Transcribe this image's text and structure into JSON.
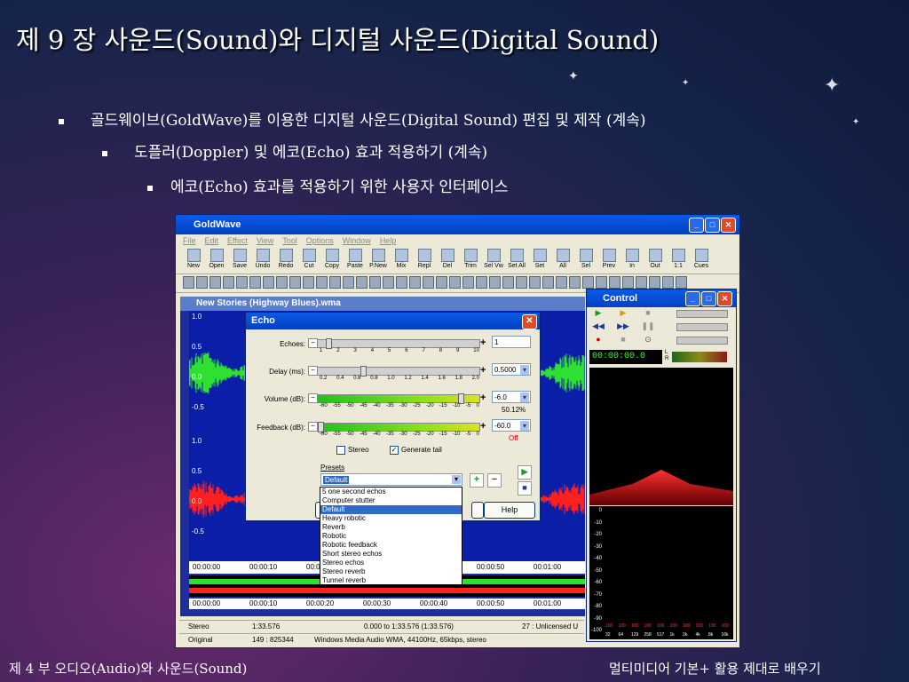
{
  "slide": {
    "title": "제 9 장 사운드(Sound)와 디지털 사운드(Digital Sound)",
    "bullet1": "골드웨이브(GoldWave)를 이용한 디지털 사운드(Digital Sound) 편집 및 제작 (계속)",
    "bullet2": "도플러(Doppler) 및 에코(Echo) 효과 적용하기 (계속)",
    "bullet3": "에코(Echo) 효과를 적용하기 위한 사용자 인터페이스",
    "footer_left": "제 4 부 오디오(Audio)와 사운드(Sound)",
    "footer_right": "멀티미디어 기본+ 활용 제대로 배우기"
  },
  "goldwave": {
    "title": "GoldWave",
    "menu": [
      "File",
      "Edit",
      "Effect",
      "View",
      "Tool",
      "Options",
      "Window",
      "Help"
    ],
    "toolbar": [
      "New",
      "Open",
      "Save",
      "Undo",
      "Redo",
      "Cut",
      "Copy",
      "Paste",
      "P.New",
      "Mix",
      "Repl",
      "Del",
      "Trim",
      "Sel Vw",
      "Set All",
      "Set",
      "All",
      "Sel",
      "Prev",
      "In",
      "Out",
      "1:1",
      "Cues"
    ],
    "doc_title": "New Stories (Highway Blues).wma",
    "y_labels_top": [
      "1.0",
      "0.5",
      "0.0",
      "-0.5"
    ],
    "y_labels_bottom": [
      "1.0",
      "0.5",
      "0.0",
      "-0.5"
    ],
    "timeline": [
      "00:00:00",
      "00:00:10",
      "00:00:20",
      "00:00:30",
      "00:00:40",
      "00:00:50",
      "00:01:00"
    ],
    "status": {
      "row1": [
        "Stereo",
        "1:33.576",
        "0.000 to 1:33.576 (1:33.576)",
        "27 : Unlicensed U"
      ],
      "row2": [
        "Original",
        "149 : 825344",
        "Windows Media Audio WMA, 44100Hz, 65kbps, stereo"
      ]
    }
  },
  "echo": {
    "title": "Echo",
    "echoes_label": "Echoes:",
    "echoes_ticks": [
      "1",
      "2",
      "3",
      "4",
      "5",
      "6",
      "7",
      "8",
      "9",
      "10"
    ],
    "echoes_value": "1",
    "echoes_level": 0.05,
    "delay_label": "Delay (ms):",
    "delay_ticks": [
      "0.2",
      "0.4",
      "0.6",
      "0.8",
      "1.0",
      "1.2",
      "1.4",
      "1.6",
      "1.8",
      "2.0"
    ],
    "delay_value": "0.5000",
    "delay_level": 0.27,
    "volume_label": "Volume (dB):",
    "db_ticks": [
      "-60",
      "-55",
      "-50",
      "-45",
      "-40",
      "-35",
      "-30",
      "-25",
      "-20",
      "-15",
      "-10",
      "-5",
      "0"
    ],
    "volume_value": "-6.0",
    "volume_note": "50.12%",
    "volume_level": 0.9,
    "feedback_label": "Feedback (dB):",
    "feedback_value": "-60.0",
    "feedback_note": "Off",
    "feedback_level": 0.0,
    "stereo_label": "Stereo",
    "tail_label": "Generate tail",
    "presets_label": "Presets",
    "preset_selected": "Default",
    "help_label": "Help",
    "preset_options": [
      "5 one second echos",
      "Computer stutter",
      "Default",
      "Heavy robotic",
      "Reverb",
      "Robotic",
      "Robotic feedback",
      "Short stereo echos",
      "Stereo echos",
      "Stereo reverb",
      "Tunnel reverb"
    ]
  },
  "control": {
    "title": "Control",
    "timer": "00:00:00.0",
    "lr": "L\nR",
    "spectrum_y": [
      "0",
      "-10",
      "-20",
      "-30",
      "-40",
      "-50",
      "-60",
      "-70",
      "-80",
      "-90",
      "-100"
    ],
    "spectrum_x": [
      "32",
      "64",
      "129",
      "258",
      "517",
      "1k",
      "2k",
      "4k",
      "8k",
      "16k"
    ],
    "spectrum_r": [
      "100",
      "100",
      "100",
      "100",
      "100",
      "100",
      "100",
      "100",
      "100",
      "100"
    ]
  }
}
